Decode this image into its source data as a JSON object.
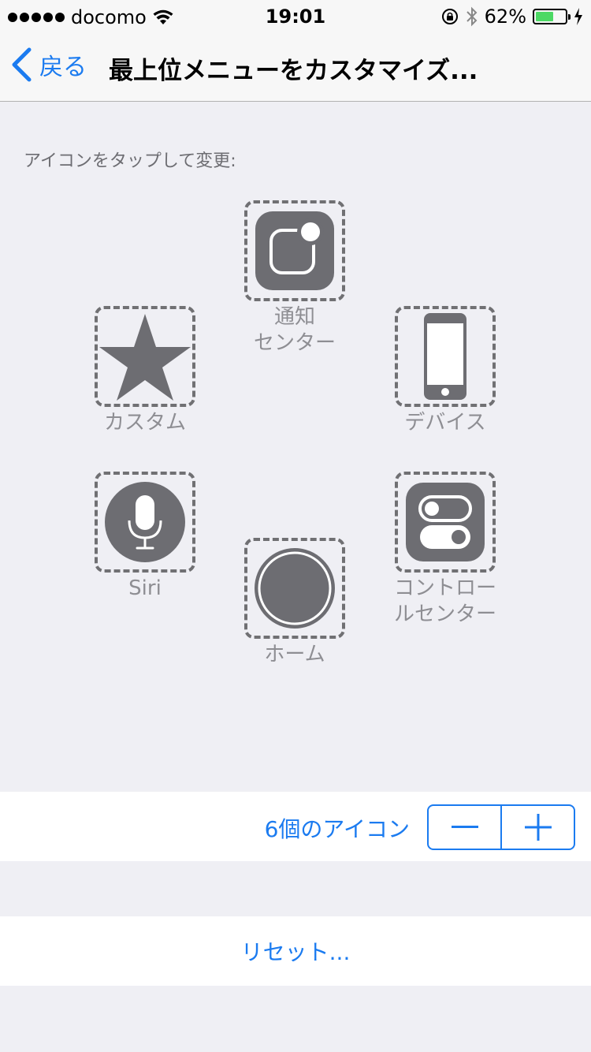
{
  "status_bar": {
    "carrier": "docomo",
    "time": "19:01",
    "battery_percent": "62%",
    "battery_level": 0.62,
    "battery_color": "#4cd964"
  },
  "nav": {
    "back_label": "戻る",
    "title": "最上位メニューをカスタマイズ..."
  },
  "instruction": "アイコンをタップして変更:",
  "menu": {
    "notification_center": {
      "label": "通知\nセンター",
      "icon": "notification-center-icon"
    },
    "custom": {
      "label": "カスタム",
      "icon": "star-icon"
    },
    "device": {
      "label": "デバイス",
      "icon": "device-icon"
    },
    "siri": {
      "label": "Siri",
      "icon": "microphone-icon"
    },
    "home": {
      "label": "ホーム",
      "icon": "home-button-icon"
    },
    "control_center": {
      "label": "コントロー\nルセンター",
      "icon": "control-center-icon"
    }
  },
  "count": {
    "label": "6個のアイコン",
    "value": 6,
    "minus_icon": "minus-icon",
    "plus_icon": "plus-icon"
  },
  "reset": {
    "label": "リセット..."
  },
  "colors": {
    "accent": "#1b7bf0",
    "icon_gray": "#6d6d72",
    "background": "#efeff4"
  }
}
